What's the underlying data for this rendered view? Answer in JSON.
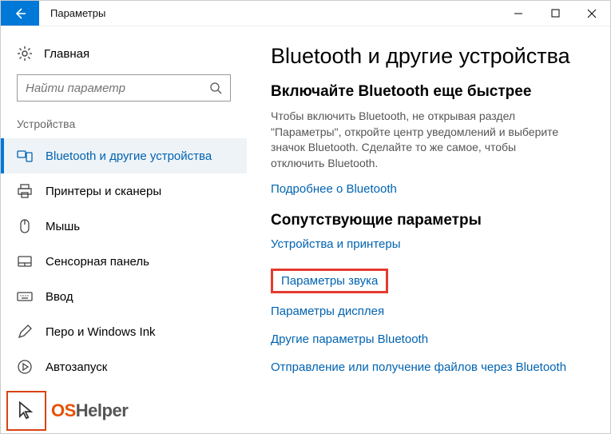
{
  "window": {
    "title": "Параметры"
  },
  "sidebar": {
    "home": "Главная",
    "search_placeholder": "Найти параметр",
    "category": "Устройства",
    "items": [
      {
        "label": "Bluetooth и другие устройства"
      },
      {
        "label": "Принтеры и сканеры"
      },
      {
        "label": "Мышь"
      },
      {
        "label": "Сенсорная панель"
      },
      {
        "label": "Ввод"
      },
      {
        "label": "Перо и Windows Ink"
      },
      {
        "label": "Автозапуск"
      }
    ]
  },
  "main": {
    "heading": "Bluetooth и другие устройства",
    "subheading": "Включайте Bluetooth еще быстрее",
    "description": "Чтобы включить Bluetooth, не открывая раздел \"Параметры\", откройте центр уведомлений и выберите значок Bluetooth. Сделайте то же самое, чтобы отключить Bluetooth.",
    "learn_more": "Подробнее о Bluetooth",
    "related_heading": "Сопутствующие параметры",
    "links": {
      "devices_printers": "Устройства и принтеры",
      "sound": "Параметры звука",
      "display": "Параметры дисплея",
      "other_bluetooth": "Другие параметры Bluetooth",
      "send_receive": "Отправление или получение файлов через Bluetooth"
    }
  },
  "watermark": {
    "os": "OS",
    "helper": "Helper"
  }
}
